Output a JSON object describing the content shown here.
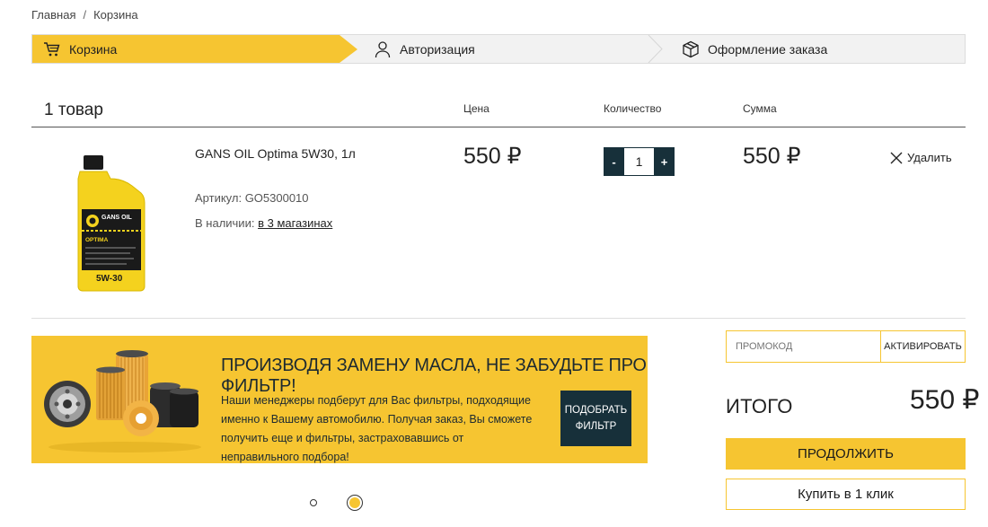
{
  "breadcrumb": {
    "home": "Главная",
    "separator": "/",
    "current": "Корзина"
  },
  "steps": [
    {
      "label": "Корзина",
      "icon": "cart-icon"
    },
    {
      "label": "Авторизация",
      "icon": "user-icon"
    },
    {
      "label": "Оформление заказа",
      "icon": "box-icon"
    }
  ],
  "cart": {
    "count_label": "1 товар",
    "columns": {
      "price": "Цена",
      "qty": "Количество",
      "sum": "Сумма"
    }
  },
  "product": {
    "name": "GANS OIL Optima 5W30, 1л",
    "sku": "Артикул: GO5300010",
    "stock_prefix": "В наличии:",
    "stock_link": "в 3 магазинах",
    "price": "550 ₽",
    "qty_minus": "-",
    "qty_value": "1",
    "qty_plus": "+",
    "sum": "550 ₽",
    "remove_label": "Удалить",
    "image_brand": "GANS OIL",
    "image_line": "OPTIMA",
    "image_viscosity": "5W-30"
  },
  "banner": {
    "title": "ПРОИЗВОДЯ ЗАМЕНУ МАСЛА, НЕ ЗАБУДЬТЕ ПРО ФИЛЬТР!",
    "text": "Наши менеджеры подберут для Вас фильтры, подходящие именно к Вашему автомобилю. Получая заказ, Вы сможете получить еще и фильтры, застраховавшись от неправильного подбора!",
    "button_line1": "ПОДОБРАТЬ",
    "button_line2": "ФИЛЬТР"
  },
  "summary": {
    "promo_placeholder": "ПРОМОКОД",
    "promo_button": "АКТИВИРОВАТЬ",
    "total_label": "ИТОГО",
    "total_value": "550 ₽",
    "continue_label": "ПРОДОЛЖИТЬ",
    "oneclick_label": "Купить в 1 клик"
  },
  "colors": {
    "accent": "#f6c531",
    "dark": "#17303a"
  }
}
